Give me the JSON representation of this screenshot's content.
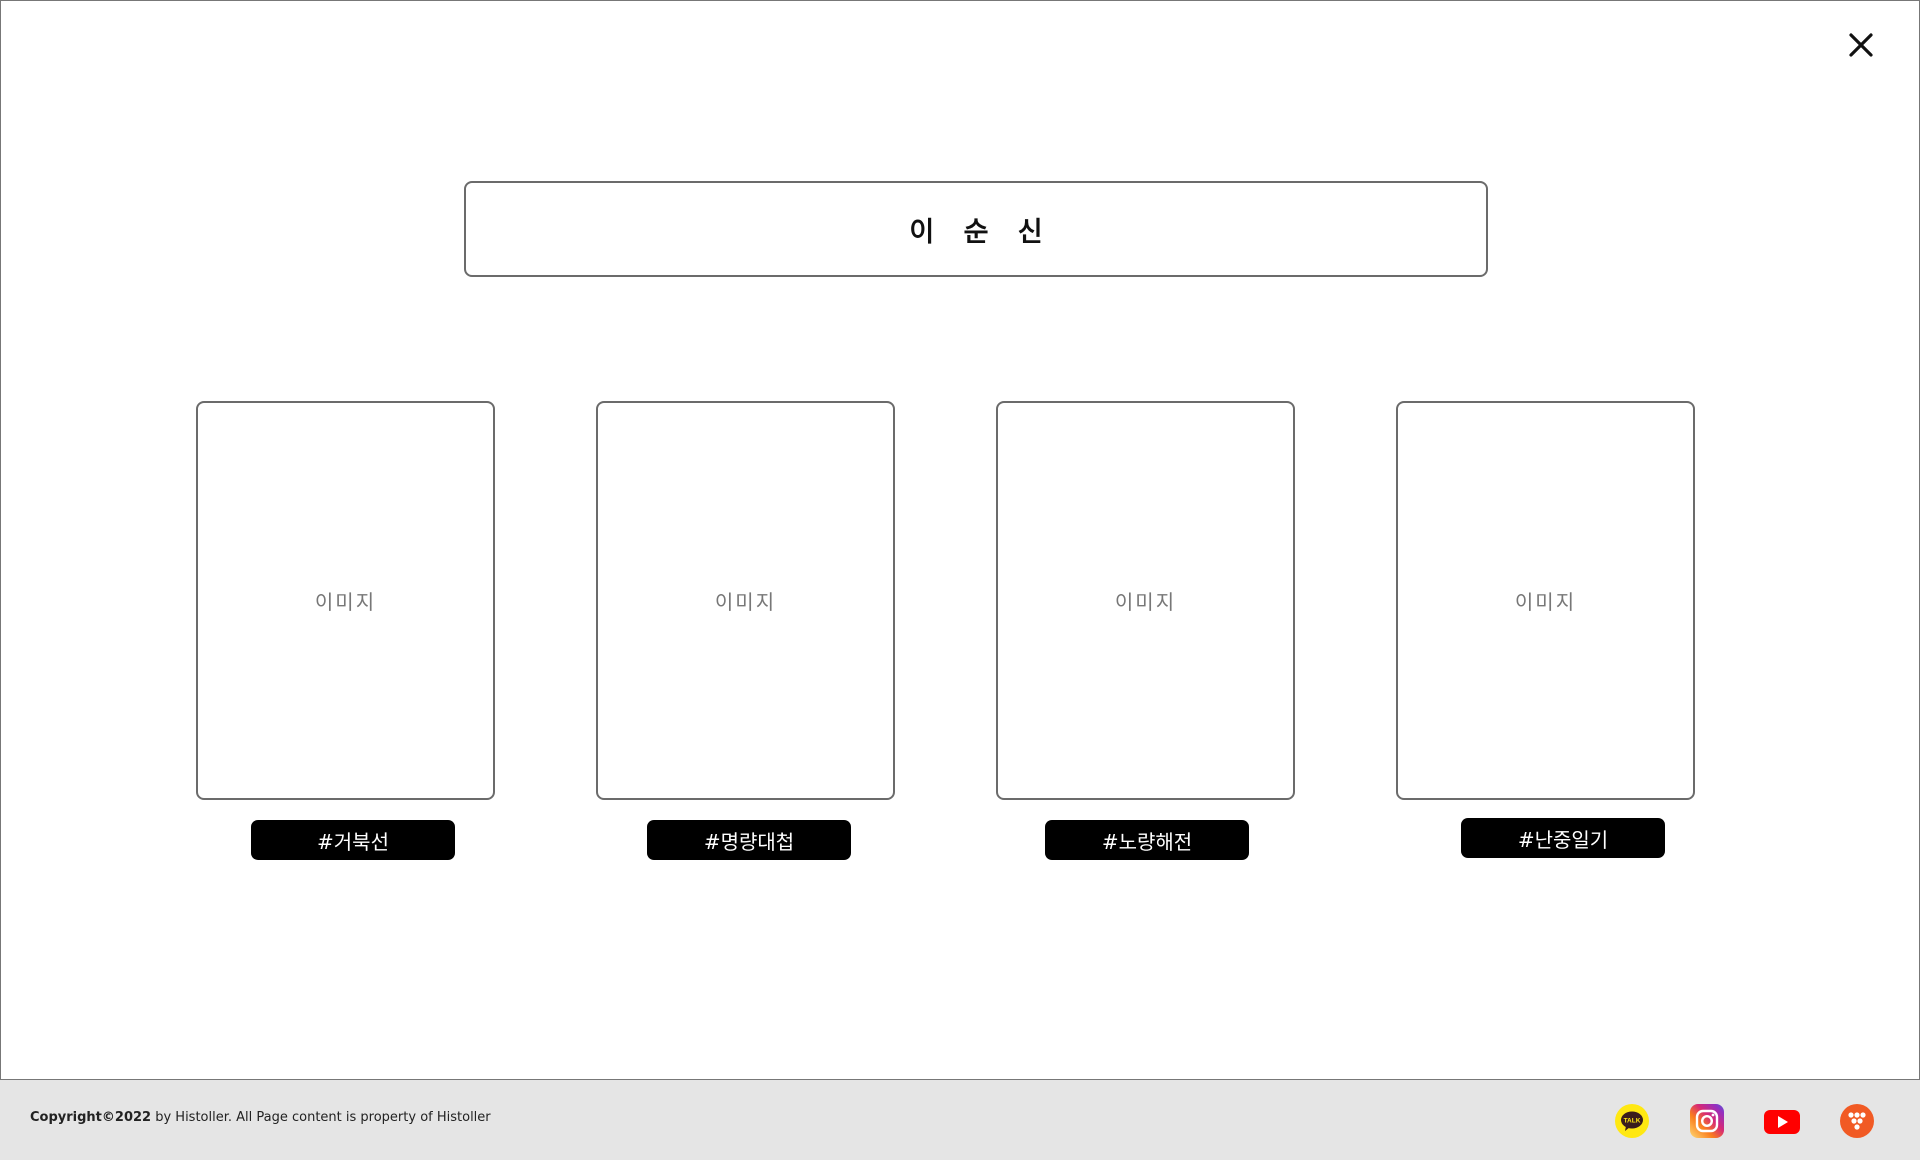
{
  "modal": {
    "close_label": "✕",
    "person_name": "이 순 신"
  },
  "cards": [
    {
      "placeholder": "이미지",
      "tag": "#거북선"
    },
    {
      "placeholder": "이미지",
      "tag": "#명량대첩"
    },
    {
      "placeholder": "이미지",
      "tag": "#노량해전"
    },
    {
      "placeholder": "이미지",
      "tag": "#난중일기"
    }
  ],
  "footer": {
    "copyright_bold": "Copyright©2022",
    "copyright_rest": " by Histoller. All Page content is property of Histoller",
    "kakao_text": "TALK"
  },
  "colors": {
    "kakao": "#FFE812",
    "youtube": "#FF0000",
    "misc": "#F15A24",
    "footer_bg": "#e5e5e5"
  },
  "icons": [
    "close-icon",
    "kakaotalk-icon",
    "instagram-icon",
    "youtube-icon",
    "brand-dots-icon"
  ]
}
